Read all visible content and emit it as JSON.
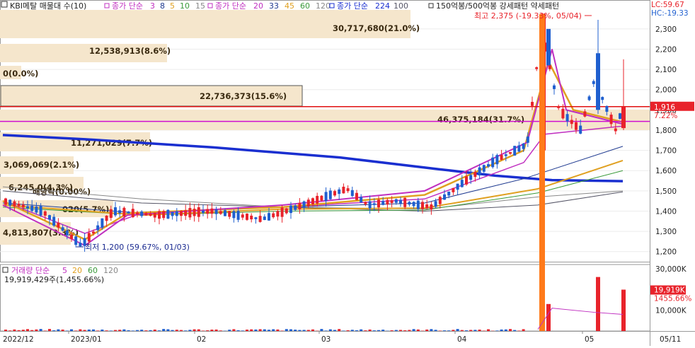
{
  "legend_top": {
    "stock": "KBI메탈 매물대 수(10)",
    "ma_group1_label": "종가 단순",
    "ma_group1_periods": [
      "3",
      "8",
      "5",
      "10",
      "15"
    ],
    "ma_group2_label": "종가 단순",
    "ma_group2_periods": [
      "20",
      "33",
      "45",
      "60",
      "120"
    ],
    "ma_group3_label": "종가 단순",
    "ma_group3_periods": [
      "224",
      "100"
    ],
    "pattern": "150억봉/500억봉 강세패턴  약세패턴",
    "lc": "LC:59.67",
    "hc": "HC:-19.33"
  },
  "volume_profile": [
    "30,717,680(21.0%)",
    "12,538,913(8.6%)",
    "0(0.0%)",
    "22,736,373(15.6%)",
    "46,375,184(31.7%)",
    "11,271,029(7.7%)",
    "3,069,069(2.1%)",
    "6,245,0(4.3%)",
    "배당락(0.00%)",
    "020(5.7%)",
    "4,813,807(3.3%)"
  ],
  "annotations": {
    "high": "최고 2,375 (-19.33%, 05/04)",
    "low": "최저 1,200 (59.67%, 01/03)"
  },
  "price_axis": [
    "2,300",
    "2,200",
    "2,100",
    "2,000",
    "1,900",
    "1,800",
    "1,700",
    "1,600",
    "1,500",
    "1,400",
    "1,300",
    "1,200"
  ],
  "current_price": "1,916",
  "current_change": "7.22%",
  "volume_legend": {
    "label": "거래량 단순",
    "periods": [
      "5",
      "20",
      "60",
      "120"
    ],
    "current": "19,919,429주(1,455.66%)"
  },
  "volume_axis": [
    "30,000K",
    "10,000K"
  ],
  "volume_current": "19,919K",
  "volume_current_pct": "1455.66%",
  "date_axis": [
    "2022/12",
    "2023/01",
    "02",
    "03",
    "04",
    "05",
    "05/11"
  ],
  "colors": {
    "up": "#e8232b",
    "down": "#1f5fcf",
    "volume_profile": "#f5e6cc",
    "ma224": "#1a2fd0",
    "spike_volume": "#ff7a1a",
    "hline_red": "#e01010",
    "hline_magenta": "#d010d0"
  },
  "chart_data": {
    "type": "candlestick",
    "x": [
      "2022/12",
      "2023/01",
      "02",
      "03",
      "04",
      "05"
    ],
    "y_axis_range": [
      1150,
      2380
    ],
    "high": 2375,
    "low": 1200,
    "current": 1916
  }
}
